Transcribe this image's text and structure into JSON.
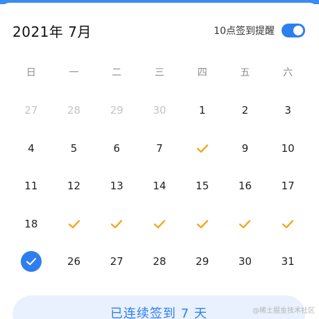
{
  "header": {
    "month_title": "2021年 7月",
    "reminder_label": "10点签到提醒",
    "reminder_on": true
  },
  "weekdays": [
    "日",
    "一",
    "二",
    "三",
    "四",
    "五",
    "六"
  ],
  "days": [
    {
      "label": "27",
      "state": "other-month"
    },
    {
      "label": "28",
      "state": "other-month"
    },
    {
      "label": "29",
      "state": "other-month"
    },
    {
      "label": "30",
      "state": "other-month"
    },
    {
      "label": "1",
      "state": "normal"
    },
    {
      "label": "2",
      "state": "normal"
    },
    {
      "label": "3",
      "state": "normal"
    },
    {
      "label": "4",
      "state": "normal"
    },
    {
      "label": "5",
      "state": "normal"
    },
    {
      "label": "6",
      "state": "normal"
    },
    {
      "label": "7",
      "state": "normal"
    },
    {
      "label": "",
      "state": "checked"
    },
    {
      "label": "9",
      "state": "normal"
    },
    {
      "label": "10",
      "state": "normal"
    },
    {
      "label": "11",
      "state": "normal"
    },
    {
      "label": "12",
      "state": "normal"
    },
    {
      "label": "13",
      "state": "normal"
    },
    {
      "label": "14",
      "state": "normal"
    },
    {
      "label": "15",
      "state": "normal"
    },
    {
      "label": "16",
      "state": "normal"
    },
    {
      "label": "17",
      "state": "normal"
    },
    {
      "label": "18",
      "state": "normal"
    },
    {
      "label": "",
      "state": "checked"
    },
    {
      "label": "",
      "state": "checked"
    },
    {
      "label": "",
      "state": "checked"
    },
    {
      "label": "",
      "state": "checked"
    },
    {
      "label": "",
      "state": "checked"
    },
    {
      "label": "",
      "state": "checked"
    },
    {
      "label": "",
      "state": "today-checked"
    },
    {
      "label": "26",
      "state": "normal"
    },
    {
      "label": "27",
      "state": "normal"
    },
    {
      "label": "28",
      "state": "normal"
    },
    {
      "label": "29",
      "state": "normal"
    },
    {
      "label": "30",
      "state": "normal"
    },
    {
      "label": "31",
      "state": "normal"
    }
  ],
  "streak": {
    "text": "已连续签到 7 天"
  },
  "watermark": "@稀土掘金技术社区",
  "colors": {
    "accent": "#2f7ef0",
    "check": "#f5a623",
    "muted": "#c4c4c4"
  }
}
